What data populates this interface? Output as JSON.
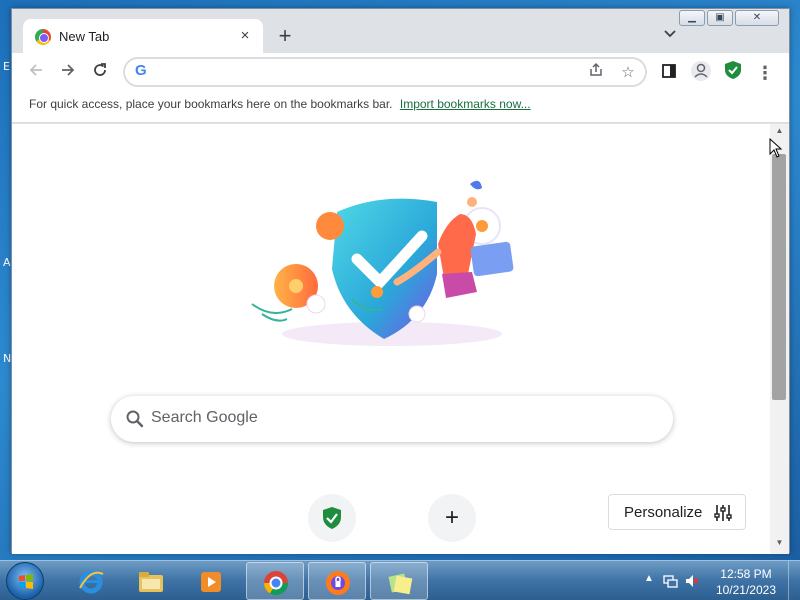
{
  "desktop": {
    "edge_letters": [
      "E",
      "A",
      "N"
    ]
  },
  "window": {
    "controls": [
      "minimize",
      "maximize",
      "close"
    ]
  },
  "tab": {
    "title": "New Tab",
    "close_icon": "×",
    "new_tab_icon": "+"
  },
  "bookmarks_bar": {
    "message": "For quick access, place your bookmarks here on the bookmarks bar.",
    "import_link": "Import bookmarks now..."
  },
  "omnibox": {
    "value": "",
    "logo": "G"
  },
  "ntp": {
    "search_placeholder": "Search Google",
    "shortcut_add": "+",
    "personalize_label": "Personalize"
  },
  "taskbar": {
    "items": [
      "internet-explorer",
      "file-explorer",
      "media-player",
      "chrome",
      "avast-browser",
      "sticky-notes"
    ],
    "clock_time": "12:58 PM",
    "clock_date": "10/21/2023"
  },
  "colors": {
    "brand_green": "#1e8e3e",
    "link_green": "#1a6e43",
    "taskbar_blue": "#3f73a5"
  }
}
